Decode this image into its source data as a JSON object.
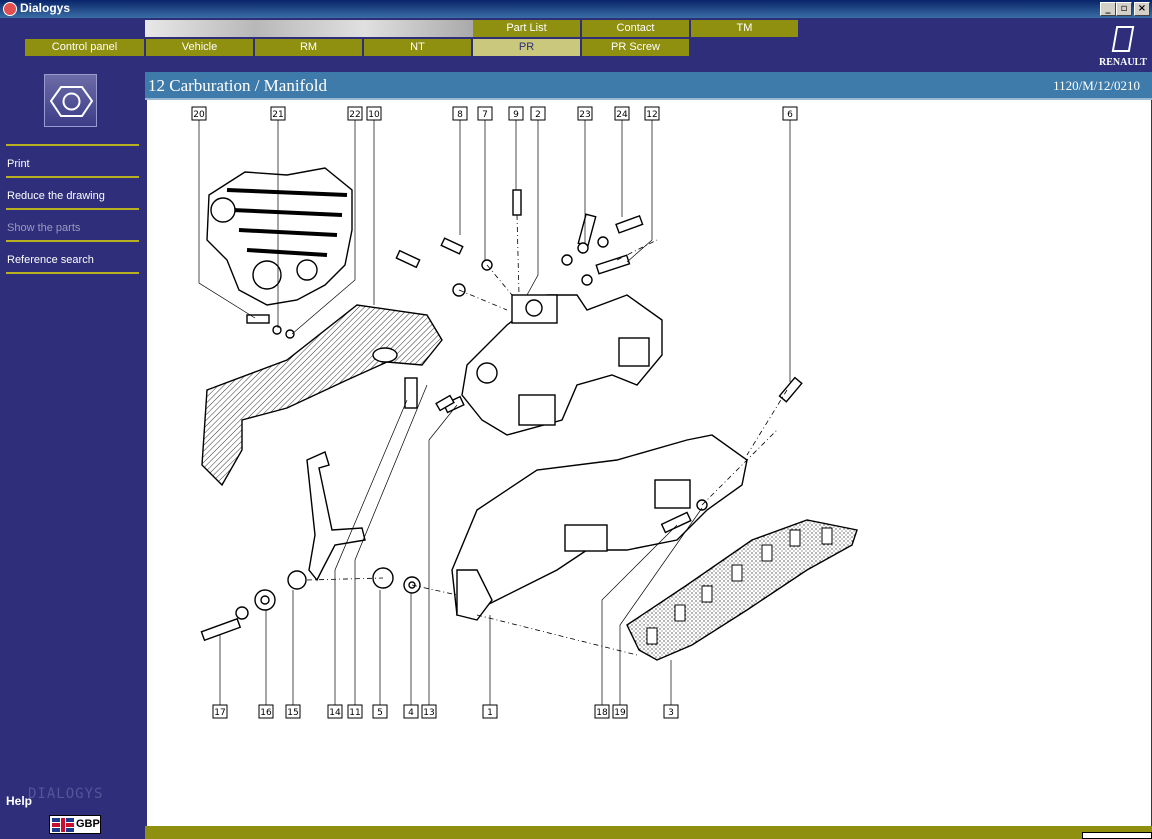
{
  "window": {
    "title": "Dialogys",
    "controls": [
      "_",
      "▫",
      "×"
    ]
  },
  "header": {
    "top_tabs": [
      "Part List",
      "Contact",
      "TM"
    ],
    "bottom_tabs": [
      "Control panel",
      "Vehicle",
      "RM",
      "NT",
      "PR",
      "PR Screw"
    ],
    "active_tab": "PR",
    "brand": "RENAULT",
    "colors": {
      "tab": "#8f8f10",
      "tab_active": "#c9c87d",
      "background": "#2e2e7a"
    }
  },
  "sidebar": {
    "menu": [
      {
        "label": "Print",
        "enabled": true
      },
      {
        "label": "Reduce the drawing",
        "enabled": true
      },
      {
        "label": "Show the parts",
        "enabled": false
      },
      {
        "label": "Reference search",
        "enabled": true
      }
    ],
    "help": "Help",
    "wordmark": "DIALOGYS",
    "currency": "GBP"
  },
  "document": {
    "title": "12 Carburation / Manifold",
    "reference": "1120/M/12/0210",
    "callouts_top": [
      "20",
      "21",
      "22",
      "10",
      "8",
      "7",
      "9",
      "2",
      "23",
      "24",
      "12",
      "6"
    ],
    "callouts_bottom": [
      "17",
      "16",
      "15",
      "14",
      "11",
      "5",
      "4",
      "13",
      "1",
      "18",
      "19",
      "3"
    ]
  }
}
